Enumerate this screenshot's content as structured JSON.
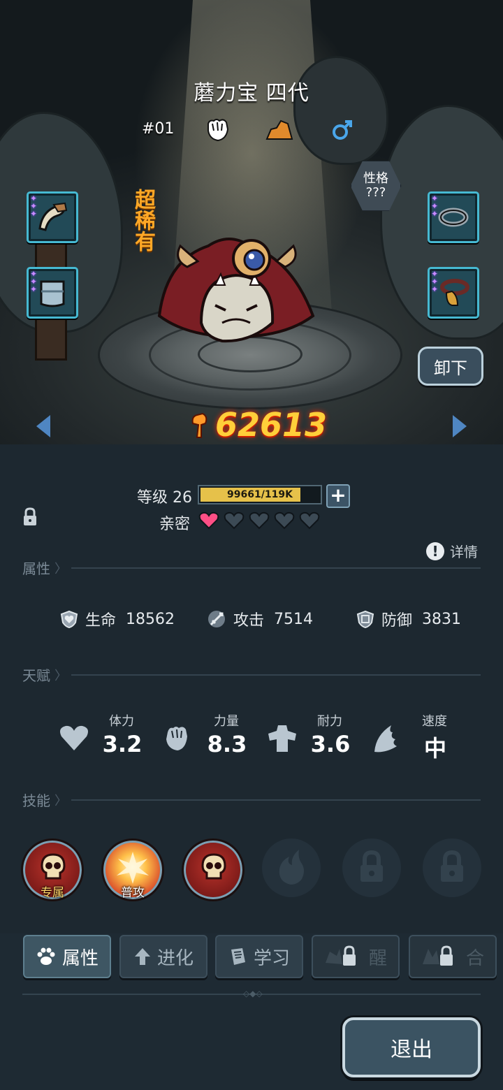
{
  "pet": {
    "name": "蘑力宝 四代",
    "number": "#01",
    "rarity": "超稀有",
    "trait": {
      "label": "性格",
      "value": "???"
    },
    "power": "62613",
    "icons": [
      "fist-icon",
      "terrain-rock-icon",
      "male-icon"
    ]
  },
  "scene": {
    "unequip_label": "卸下",
    "equipment_slots": [
      "horn-gear",
      "armor-vest",
      "ring-band",
      "bell-collar"
    ]
  },
  "level": {
    "label": "等级 26",
    "xp_text": "99661/119K",
    "xp_fraction": 0.84
  },
  "affinity": {
    "label": "亲密",
    "hearts_filled": 1,
    "hearts_total": 5
  },
  "detail_label": "详情",
  "sections": {
    "attributes": "属性",
    "talents": "天赋",
    "skills": "技能"
  },
  "stats": [
    {
      "label": "生命",
      "value": "18562",
      "icon": "shield-heart-icon"
    },
    {
      "label": "攻击",
      "value": "7514",
      "icon": "sword-icon"
    },
    {
      "label": "防御",
      "value": "3831",
      "icon": "armor-icon"
    }
  ],
  "talents": [
    {
      "label": "体力",
      "value": "3.2",
      "icon": "heart-icon"
    },
    {
      "label": "力量",
      "value": "8.3",
      "icon": "fist-icon"
    },
    {
      "label": "耐力",
      "value": "3.6",
      "icon": "muscle-icon"
    },
    {
      "label": "速度",
      "value": "中",
      "icon": "wing-icon"
    }
  ],
  "skills": [
    {
      "tag": "专属",
      "state": "active",
      "icon": "skull-icon"
    },
    {
      "tag": "普攻",
      "state": "active",
      "icon": "burst-icon"
    },
    {
      "tag": "",
      "state": "active",
      "icon": "skull-icon"
    },
    {
      "tag": "",
      "state": "locked",
      "icon": "flame-icon"
    },
    {
      "tag": "",
      "state": "locked",
      "icon": "lock-icon"
    },
    {
      "tag": "",
      "state": "locked",
      "icon": "lock-icon"
    }
  ],
  "tabs": [
    {
      "label": "属性",
      "icon": "paw-icon",
      "active": true
    },
    {
      "label": "进化",
      "icon": "evolve-arrow-icon",
      "active": false
    },
    {
      "label": "学习",
      "icon": "book-icon",
      "active": false
    },
    {
      "label": "醒",
      "icon": "lock-icon",
      "active": false
    },
    {
      "label": "合",
      "icon": "lock-icon",
      "active": false
    }
  ],
  "exit_label": "退出",
  "colors": {
    "power": "#ffcf3a",
    "rarity": "#ffa826",
    "accent_slot": "#46b9d2",
    "heart_filled": "#ff4f86"
  }
}
